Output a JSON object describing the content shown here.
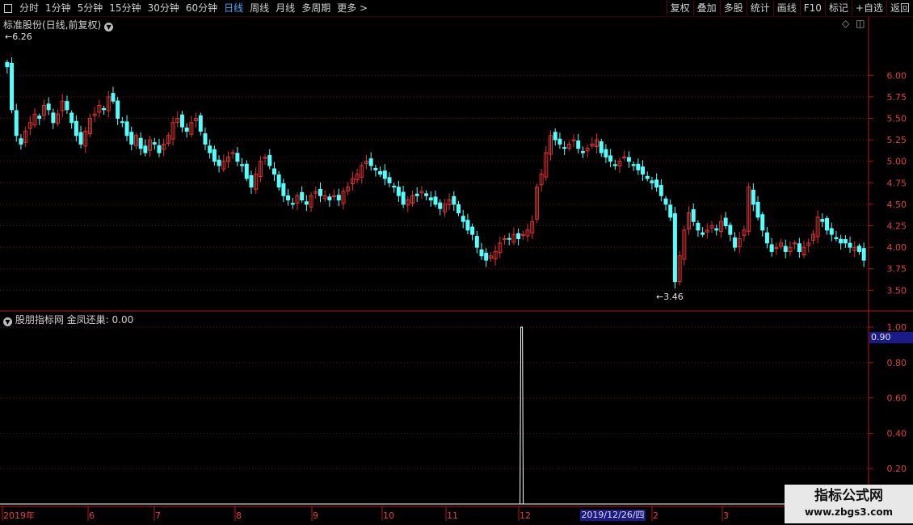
{
  "toolbar": {
    "periods": [
      "分时",
      "1分钟",
      "5分钟",
      "15分钟",
      "30分钟",
      "60分钟",
      "日线",
      "周线",
      "月线",
      "多周期",
      "更多 >"
    ],
    "active_period": "日线",
    "right_buttons": [
      "复权",
      "叠加",
      "多股",
      "统计",
      "画线",
      "F10",
      "标记",
      "+自选",
      "返回"
    ]
  },
  "main_panel": {
    "title": "标准股份(日线,前复权)",
    "high_label": "6.26",
    "low_label": "3.46",
    "axis_ticks": [
      "6.00",
      "5.75",
      "5.50",
      "5.25",
      "5.00",
      "4.75",
      "4.50",
      "4.25",
      "4.00",
      "3.75",
      "3.50"
    ],
    "icons": [
      "diamond-icon",
      "window-icon"
    ]
  },
  "indicator_panel": {
    "title": "股朋指标网 金凤还巢: 0.00",
    "axis_ticks": [
      "1.00",
      "0.80",
      "0.60",
      "0.40",
      "0.20"
    ],
    "cursor_value": "0.90"
  },
  "date_axis": {
    "labels": [
      "2019年",
      "6",
      "7",
      "8",
      "9",
      "10",
      "11",
      "12",
      "2",
      "3"
    ],
    "cursor_date": "2019/12/26/四"
  },
  "watermark": {
    "line1": "指标公式网",
    "line2": "www.zbgs3.com"
  },
  "colors": {
    "up": "#e03030",
    "down": "#54ffff",
    "grid": "#7a1010",
    "bg": "#000000"
  },
  "chart_data": {
    "type": "candlestick",
    "ylim": [
      3.4,
      6.35
    ],
    "closes": [
      6.1,
      5.6,
      5.3,
      5.2,
      5.35,
      5.45,
      5.55,
      5.5,
      5.65,
      5.6,
      5.45,
      5.55,
      5.7,
      5.6,
      5.45,
      5.3,
      5.2,
      5.35,
      5.5,
      5.55,
      5.65,
      5.6,
      5.75,
      5.7,
      5.5,
      5.45,
      5.3,
      5.2,
      5.3,
      5.15,
      5.1,
      5.25,
      5.2,
      5.1,
      5.2,
      5.3,
      5.45,
      5.5,
      5.4,
      5.35,
      5.45,
      5.5,
      5.35,
      5.2,
      5.1,
      5.0,
      4.95,
      5.0,
      5.05,
      5.1,
      5.0,
      4.95,
      4.8,
      4.7,
      4.85,
      5.0,
      5.05,
      4.95,
      4.85,
      4.7,
      4.6,
      4.55,
      4.5,
      4.6,
      4.55,
      4.5,
      4.6,
      4.65,
      4.6,
      4.6,
      4.55,
      4.6,
      4.55,
      4.65,
      4.7,
      4.8,
      4.85,
      4.95,
      5.0,
      4.95,
      4.9,
      4.85,
      4.8,
      4.75,
      4.7,
      4.6,
      4.5,
      4.55,
      4.6,
      4.6,
      4.65,
      4.6,
      4.55,
      4.5,
      4.45,
      4.5,
      4.55,
      4.5,
      4.4,
      4.3,
      4.2,
      4.15,
      4.0,
      3.9,
      3.85,
      3.9,
      3.95,
      4.05,
      4.1,
      4.1,
      4.15,
      4.1,
      4.15,
      4.2,
      4.3,
      4.7,
      4.85,
      5.1,
      5.3,
      5.25,
      5.2,
      5.15,
      5.2,
      5.25,
      5.15,
      5.1,
      5.15,
      5.2,
      5.25,
      5.1,
      5.05,
      5.0,
      4.95,
      5.0,
      5.05,
      5.0,
      4.95,
      4.9,
      4.85,
      4.8,
      4.75,
      4.7,
      4.6,
      4.5,
      4.35,
      3.6,
      3.9,
      4.2,
      4.4,
      4.3,
      4.2,
      4.15,
      4.2,
      4.25,
      4.2,
      4.3,
      4.25,
      4.15,
      4.0,
      4.1,
      4.2,
      4.7,
      4.5,
      4.35,
      4.2,
      4.05,
      3.95,
      4.0,
      4.05,
      3.95,
      4.0,
      4.05,
      3.95,
      4.0,
      4.05,
      4.15,
      4.35,
      4.3,
      4.2,
      4.15,
      4.1,
      4.05,
      4.05,
      4.0,
      4.0,
      3.95,
      3.85
    ],
    "spike_x_fraction": 0.6,
    "spike_value": 1.0
  }
}
